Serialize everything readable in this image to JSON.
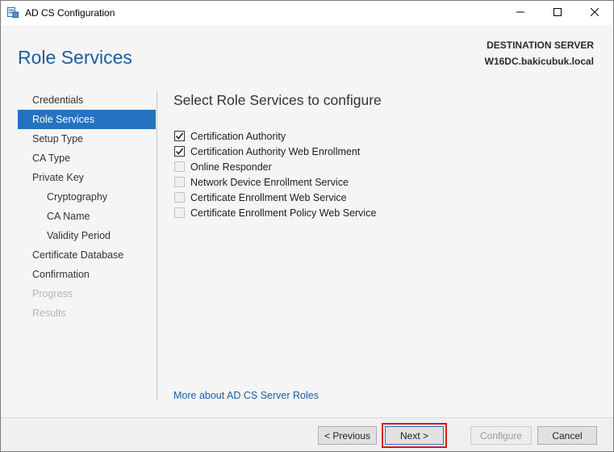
{
  "window": {
    "title": "AD CS Configuration",
    "icons": {
      "app": "server-manager-icon",
      "minimize": "minimize-icon",
      "maximize": "maximize-icon",
      "close": "close-icon"
    }
  },
  "header": {
    "page_title": "Role Services",
    "destination_label": "DESTINATION SERVER",
    "destination_server": "W16DC.bakicubuk.local"
  },
  "nav": {
    "items": [
      {
        "label": "Credentials",
        "state": "normal",
        "level": 0
      },
      {
        "label": "Role Services",
        "state": "active",
        "level": 0
      },
      {
        "label": "Setup Type",
        "state": "normal",
        "level": 0
      },
      {
        "label": "CA Type",
        "state": "normal",
        "level": 0
      },
      {
        "label": "Private Key",
        "state": "normal",
        "level": 0
      },
      {
        "label": "Cryptography",
        "state": "normal",
        "level": 1
      },
      {
        "label": "CA Name",
        "state": "normal",
        "level": 1
      },
      {
        "label": "Validity Period",
        "state": "normal",
        "level": 1
      },
      {
        "label": "Certificate Database",
        "state": "normal",
        "level": 0
      },
      {
        "label": "Confirmation",
        "state": "normal",
        "level": 0
      },
      {
        "label": "Progress",
        "state": "disabled",
        "level": 0
      },
      {
        "label": "Results",
        "state": "disabled",
        "level": 0
      }
    ]
  },
  "content": {
    "section_title": "Select Role Services to configure",
    "roles": [
      {
        "label": "Certification Authority",
        "checked": true,
        "enabled": true
      },
      {
        "label": "Certification Authority Web Enrollment",
        "checked": true,
        "enabled": true
      },
      {
        "label": "Online Responder",
        "checked": false,
        "enabled": true
      },
      {
        "label": "Network Device Enrollment Service",
        "checked": false,
        "enabled": true
      },
      {
        "label": "Certificate Enrollment Web Service",
        "checked": false,
        "enabled": true
      },
      {
        "label": "Certificate Enrollment Policy Web Service",
        "checked": false,
        "enabled": true
      }
    ],
    "more_link": "More about AD CS Server Roles"
  },
  "footer": {
    "previous_label": "< Previous",
    "next_label": "Next >",
    "configure_label": "Configure",
    "cancel_label": "Cancel"
  },
  "colors": {
    "accent": "#2473c1",
    "title_blue": "#1a5ea0",
    "highlight_red": "#d01b1b"
  }
}
